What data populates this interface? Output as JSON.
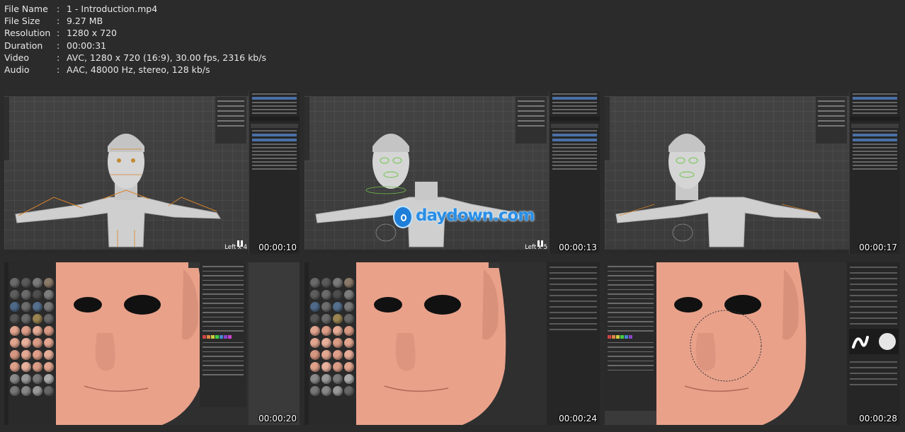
{
  "info": {
    "rows": [
      {
        "key": "File Name",
        "value": "1 - Introduction.mp4"
      },
      {
        "key": "File Size",
        "value": "9.27 MB"
      },
      {
        "key": "Resolution",
        "value": "1280 x 720"
      },
      {
        "key": "Duration",
        "value": "00:00:31"
      },
      {
        "key": "Video",
        "value": "AVC, 1280 x 720 (16:9), 30.00 fps, 2316 kb/s"
      },
      {
        "key": "Audio",
        "value": "AAC, 48000 Hz, stereo, 128 kb/s"
      }
    ],
    "separator": ":"
  },
  "thumbnails": [
    {
      "timestamp": "00:00:10",
      "view_label": "Left x 4",
      "scene": "rigging"
    },
    {
      "timestamp": "00:00:13",
      "view_label": "Left x 5",
      "scene": "rigging"
    },
    {
      "timestamp": "00:00:17",
      "view_label": "",
      "scene": "rigging"
    },
    {
      "timestamp": "00:00:20",
      "view_label": "",
      "scene": "face-painting"
    },
    {
      "timestamp": "00:00:24",
      "view_label": "",
      "scene": "face-painting"
    },
    {
      "timestamp": "00:00:28",
      "view_label": "",
      "scene": "face-painting"
    }
  ],
  "watermark": {
    "text": "daydown.com"
  },
  "colors": {
    "background": "#2b2b2b",
    "text": "#e8e8e8",
    "watermark": "#2a8ee5",
    "rig_orange": "#d9822b",
    "rig_green": "#6fc44a",
    "skin": "#e9a18a"
  }
}
